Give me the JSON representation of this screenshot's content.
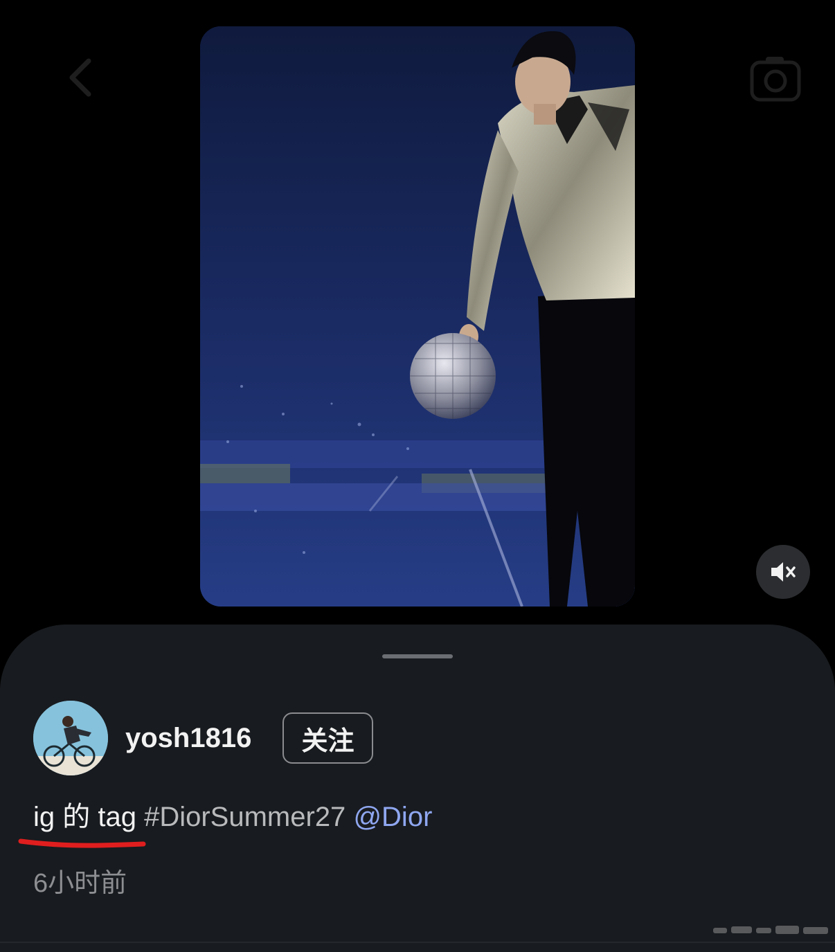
{
  "top_bar": {
    "back_icon": "chevron-left-icon",
    "title": "",
    "camera_icon": "camera-icon"
  },
  "media": {
    "description": "",
    "mute_icon": "speaker-muted-icon"
  },
  "sheet": {
    "user": {
      "username": "yosh1816",
      "follow_label": "关注"
    },
    "caption": {
      "text": "ig 的 tag",
      "hashtag": "#DiorSummer27",
      "mention": "@Dior"
    },
    "timestamp": "6小时前"
  },
  "colors": {
    "background": "#000000",
    "sheet": "#181b1f",
    "mention": "#8fa7f0",
    "annotation_underline": "#e01e1e"
  }
}
